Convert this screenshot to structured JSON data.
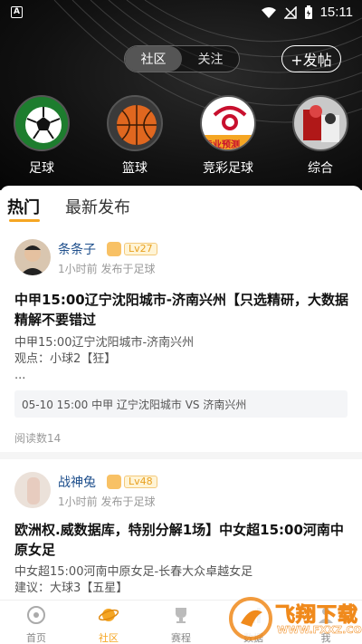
{
  "status_bar": {
    "time": "15:11",
    "left_badge": "A"
  },
  "header": {
    "segments": [
      {
        "label": "社区",
        "active": true
      },
      {
        "label": "关注",
        "active": false
      }
    ],
    "post_button": "+发帖"
  },
  "categories": [
    {
      "label": "足球",
      "icon": "soccer-ball-icon"
    },
    {
      "label": "篮球",
      "icon": "basketball-icon"
    },
    {
      "label": "竞彩足球",
      "icon": "lottery-football-icon",
      "overlay_text": "专业预测"
    },
    {
      "label": "综合",
      "icon": "general-icon"
    }
  ],
  "tabs": [
    {
      "label": "热门",
      "active": true
    },
    {
      "label": "最新发布",
      "active": false
    }
  ],
  "posts": [
    {
      "username": "条条子",
      "level": "Lv27",
      "meta": "1小时前 发布于足球",
      "title": "中甲15:00辽宁沈阳城市-济南兴州【只选精研，大数据精解不要错过",
      "body_lines": [
        "中甲15:00辽宁沈阳城市-济南兴州",
        "观点：小球2【狂】",
        "..."
      ],
      "match": "05-10 15:00 中甲 辽宁沈阳城市 VS 济南兴州",
      "reads": "阅读数14"
    },
    {
      "username": "战神兔",
      "level": "Lv48",
      "meta": "1小时前 发布于足球",
      "title": "欧洲权.威数据库，特别分解1场】中女超15:00河南中原女足",
      "body_lines": [
        "中女超15:00河南中原女足-长春大众卓越女足",
        "建议：大球3【五星】"
      ]
    }
  ],
  "bottom_nav": [
    {
      "label": "首页",
      "icon": "home-icon",
      "active": false
    },
    {
      "label": "社区",
      "icon": "planet-icon",
      "active": true
    },
    {
      "label": "赛程",
      "icon": "trophy-icon",
      "active": false
    },
    {
      "label": "数据",
      "icon": "data-icon",
      "active": false
    },
    {
      "label": "我",
      "icon": "profile-icon",
      "active": false
    }
  ],
  "watermark": {
    "text": "飞翔下载",
    "url": "WWW.FXXZ.COM"
  },
  "colors": {
    "accent": "#f5a623",
    "username": "#1e4f8c",
    "header_bg": "#111111"
  }
}
